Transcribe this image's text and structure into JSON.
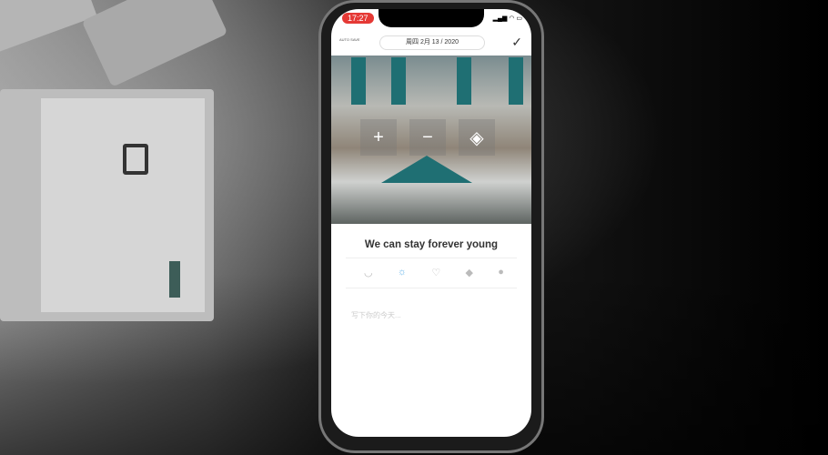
{
  "status": {
    "time": "17:27",
    "indicators": "▂▄▆ ◠ ▭"
  },
  "header": {
    "auto_save": "AUTO SAVE",
    "date": "周四 2月 13 / 2020",
    "confirm_icon": "✓"
  },
  "photo_tools": {
    "add": "+",
    "remove": "−",
    "layers": "◈"
  },
  "entry": {
    "title": "We can stay forever young",
    "placeholder": "写下你的今天...",
    "icons": [
      {
        "name": "smile",
        "glyph": "◡"
      },
      {
        "name": "weather-sun",
        "glyph": "☼"
      },
      {
        "name": "heart",
        "glyph": "♡"
      },
      {
        "name": "tag",
        "glyph": "◆"
      },
      {
        "name": "location",
        "glyph": "●"
      }
    ]
  }
}
